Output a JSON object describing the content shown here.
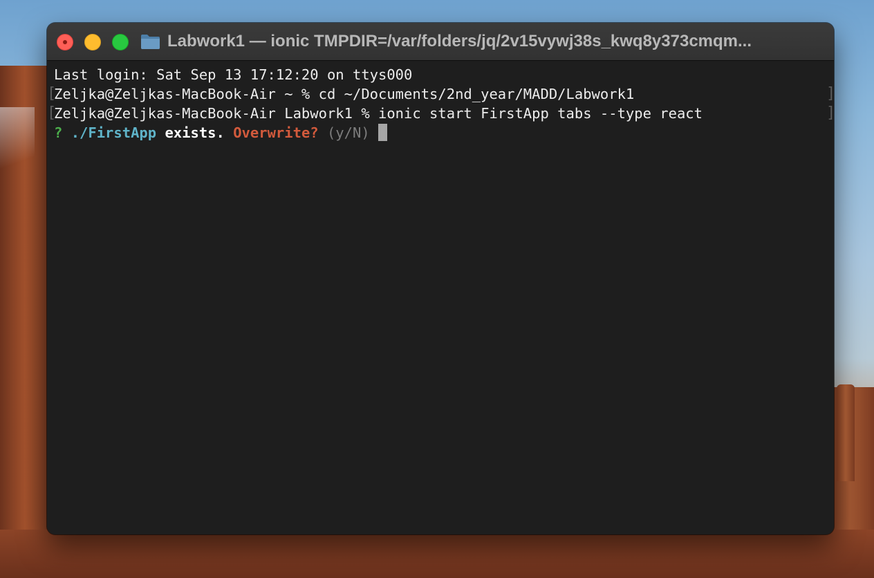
{
  "window": {
    "title": "Labwork1 — ionic TMPDIR=/var/folders/jq/2v15vywj38s_kwq8y373cmqm..."
  },
  "icons": {
    "close": "close-button",
    "minimize": "minimize-button",
    "zoom": "zoom-button",
    "folder": "folder-icon"
  },
  "terminal": {
    "last_login": "Last login: Sat Sep 13 17:12:20 on ttys000",
    "line1": "Zeljka@Zeljkas-MacBook-Air ~ % cd ~/Documents/2nd_year/MADD/Labwork1",
    "line2": "Zeljka@Zeljkas-MacBook-Air Labwork1 % ionic start FirstApp tabs --type react",
    "mark_open": "[",
    "mark_close": "]",
    "prompt": {
      "question_mark": "?",
      "path": "./FirstApp",
      "exists": "exists.",
      "overwrite": "Overwrite?",
      "choices": "(y/N)"
    }
  },
  "colors": {
    "terminal_bg": "#1e1e1e",
    "titlebar_bg": "#363636",
    "prompt_question": "#4cae4c",
    "prompt_path": "#5fb3c8",
    "prompt_warning": "#d25a3c",
    "close": "#fe5f57",
    "minimize": "#febc2e",
    "zoom": "#28c840"
  }
}
